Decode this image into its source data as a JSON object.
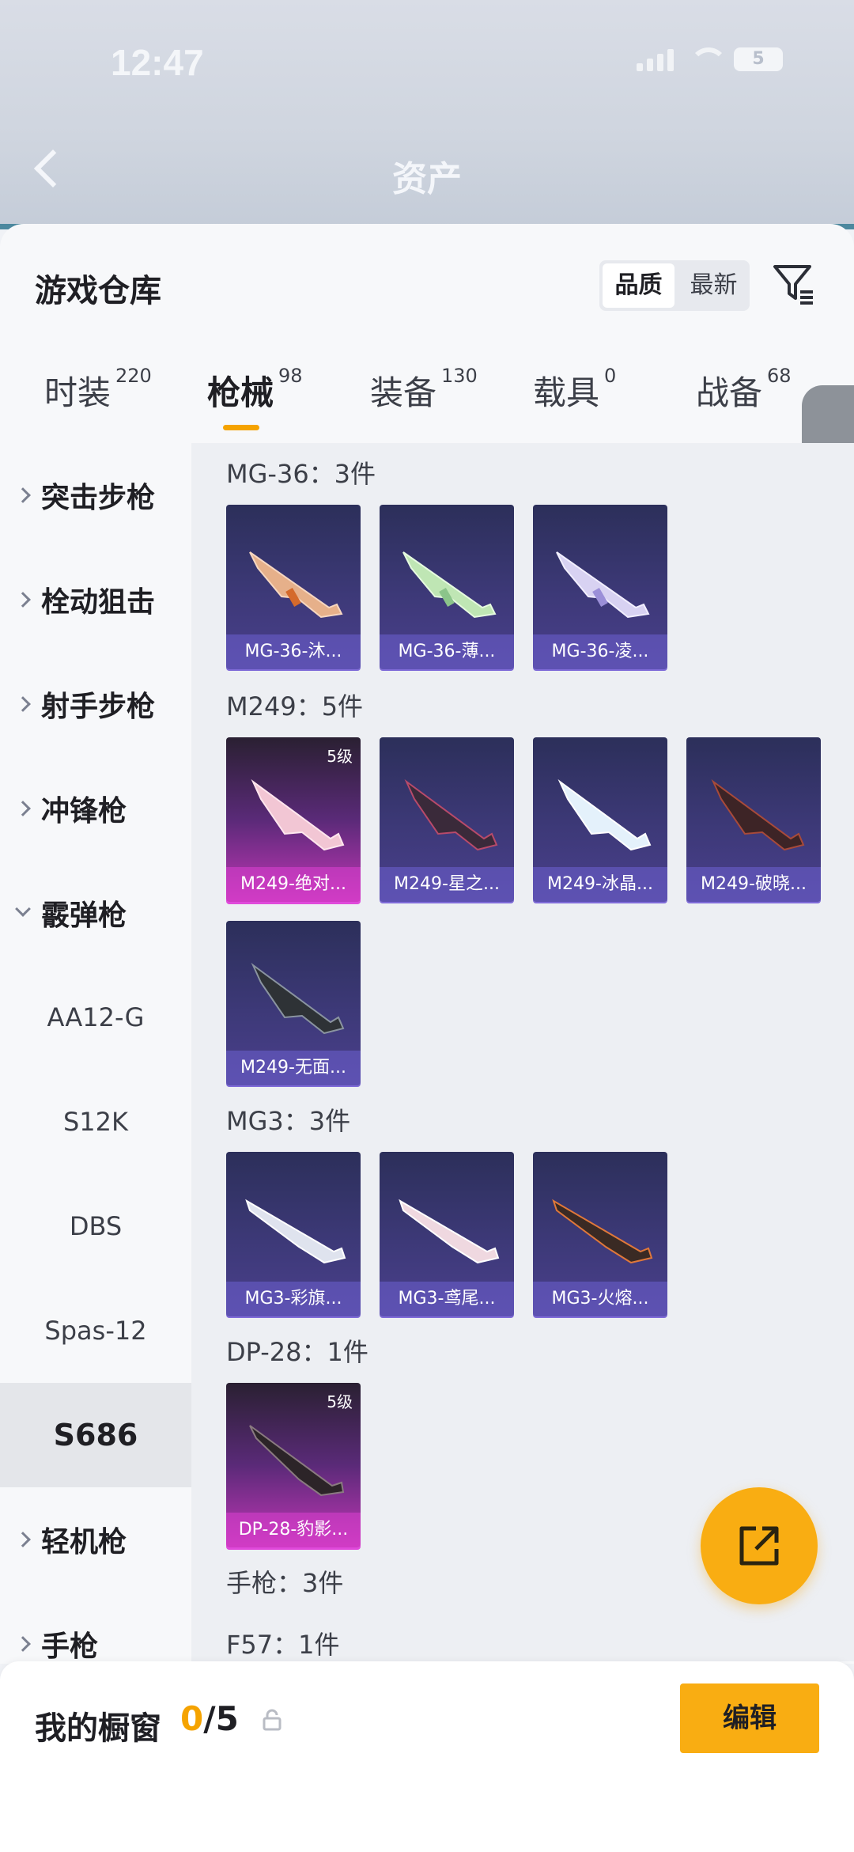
{
  "status_bar": {
    "time": "12:47",
    "battery": "5"
  },
  "header": {
    "title": "资产"
  },
  "panel": {
    "title": "游戏仓库",
    "sort_options": [
      "品质",
      "最新"
    ],
    "active_sort": "品质"
  },
  "category_tabs": [
    {
      "label": "时装",
      "count": "220"
    },
    {
      "label": "枪械",
      "count": "98"
    },
    {
      "label": "装备",
      "count": "130"
    },
    {
      "label": "载具",
      "count": "0"
    },
    {
      "label": "战备",
      "count": "68"
    }
  ],
  "active_category": "枪械",
  "left_nav": {
    "items": [
      "突击步枪",
      "栓动狙击",
      "射手步枪",
      "冲锋枪",
      "霰弹枪",
      "轻机枪",
      "手枪"
    ],
    "shotgun_sub": [
      "AA12-G",
      "S12K",
      "DBS",
      "Spas-12",
      "S686"
    ],
    "selected": "S686"
  },
  "groups": [
    {
      "header": "MG-36：3件",
      "items": [
        "MG-36-沐...",
        "MG-36-薄...",
        "MG-36-凌..."
      ]
    },
    {
      "header": "M249：5件",
      "items": [
        "M249-绝对...",
        "M249-星之...",
        "M249-冰晶...",
        "M249-破晓...",
        "M249-无面..."
      ]
    },
    {
      "header": "MG3：3件",
      "items": [
        "MG3-彩旗...",
        "MG3-鸢尾...",
        "MG3-火熔..."
      ]
    },
    {
      "header": "DP-28：1件",
      "items": [
        "DP-28-豹影..."
      ]
    },
    {
      "header": "手枪：3件"
    },
    {
      "header": "F57：1件"
    }
  ],
  "tier_label": "5级",
  "bottom_bar": {
    "title": "我的橱窗",
    "count_zero": "0",
    "count_rest": "/5",
    "edit_label": "编辑"
  },
  "colors": {
    "accent": "#f9ad12",
    "tab_underline": "#f5a300",
    "card_purple": "#3d3978",
    "card_gold": "#c236b6"
  },
  "icons": [
    "back-arrow-icon",
    "filter-icon",
    "chevron-left-icon",
    "share-export-icon",
    "lock-icon",
    "chevron-right-icon",
    "chevron-down-icon"
  ]
}
